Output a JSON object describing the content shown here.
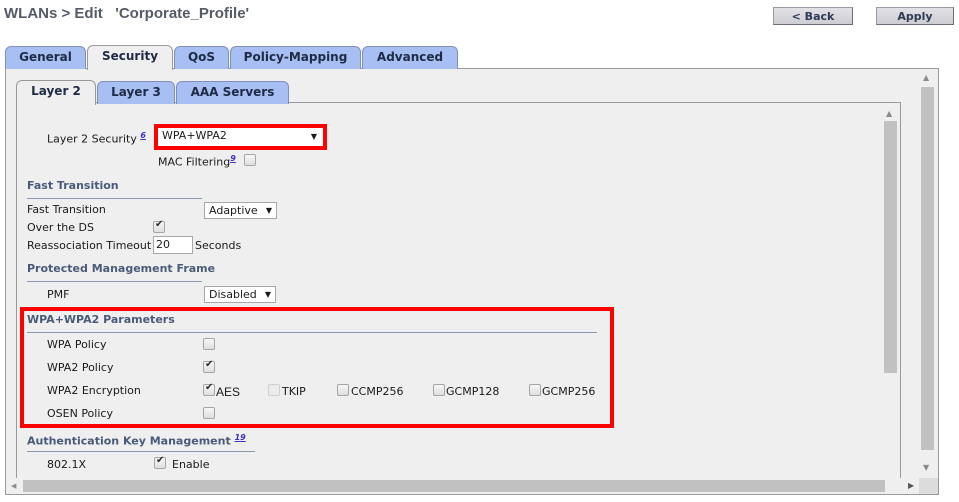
{
  "header": {
    "breadcrumb": "WLANs > Edit",
    "profile_name": "'Corporate_Profile'",
    "back_label": "< Back",
    "apply_label": "Apply"
  },
  "main_tabs": [
    {
      "label": "General",
      "active": false
    },
    {
      "label": "Security",
      "active": true
    },
    {
      "label": "QoS",
      "active": false
    },
    {
      "label": "Policy-Mapping",
      "active": false
    },
    {
      "label": "Advanced",
      "active": false
    }
  ],
  "sub_tabs": [
    {
      "label": "Layer 2",
      "active": true
    },
    {
      "label": "Layer 3",
      "active": false
    },
    {
      "label": "AAA Servers",
      "active": false
    }
  ],
  "layer2": {
    "security_label": "Layer 2 Security",
    "security_footnote": "6",
    "security_value": "WPA+WPA2",
    "mac_filtering_label": "MAC Filtering",
    "mac_filtering_footnote": "9",
    "mac_filtering_checked": false
  },
  "fast_transition": {
    "section_title": "Fast Transition",
    "ft_label": "Fast Transition",
    "ft_value": "Adaptive",
    "over_ds_label": "Over the DS",
    "over_ds_checked": true,
    "reassoc_label": "Reassociation Timeout",
    "reassoc_value": "20",
    "reassoc_unit": "Seconds"
  },
  "pmf": {
    "section_title": "Protected Management Frame",
    "pmf_label": "PMF",
    "pmf_value": "Disabled"
  },
  "wpa_params": {
    "section_title": "WPA+WPA2 Parameters",
    "wpa_policy_label": "WPA Policy",
    "wpa_policy_checked": false,
    "wpa2_policy_label": "WPA2 Policy",
    "wpa2_policy_checked": true,
    "wpa2_encryption_label": "WPA2 Encryption",
    "encryption_options": [
      {
        "label": "AES",
        "checked": true,
        "disabled": false
      },
      {
        "label": "TKIP",
        "checked": false,
        "disabled": true
      },
      {
        "label": "CCMP256",
        "checked": false,
        "disabled": false
      },
      {
        "label": "GCMP128",
        "checked": false,
        "disabled": false
      },
      {
        "label": "GCMP256",
        "checked": false,
        "disabled": false
      }
    ],
    "osen_policy_label": "OSEN Policy",
    "osen_policy_checked": false
  },
  "akm": {
    "section_title": "Authentication Key Management",
    "footnote": "19",
    "dot1x_label": "802.1X",
    "dot1x_enable_label": "Enable",
    "dot1x_checked": true
  },
  "colors": {
    "highlight": "#ff0000",
    "tab_inactive": "#a8bff3",
    "section_title": "#4a5a7a"
  }
}
